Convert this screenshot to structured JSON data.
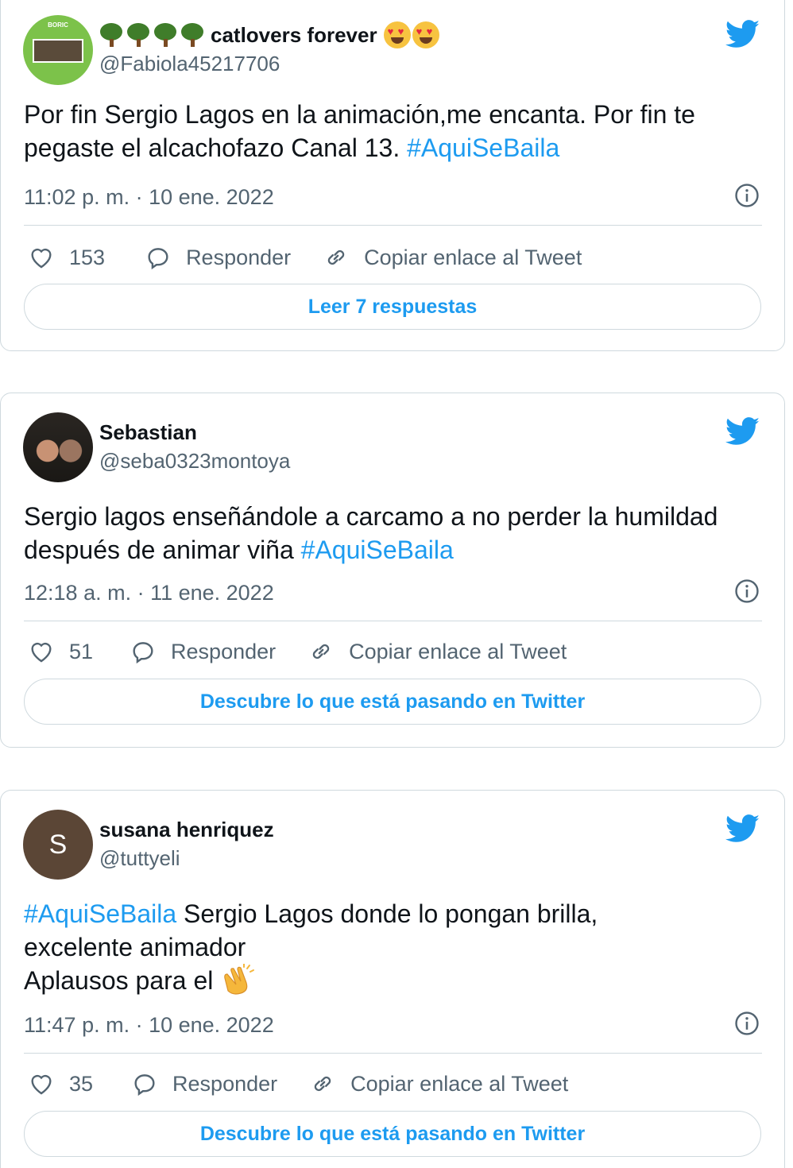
{
  "colors": {
    "accent": "#1d9bf0",
    "text": "#0f1419",
    "muted": "#536471",
    "border": "#cfd9de"
  },
  "tweets": [
    {
      "display_name": "catlovers forever",
      "handle": "@Fabiola45217706",
      "text_before": "Por fin Sergio Lagos en la animación,me encanta. Por fin te pegaste el alcachofazo Canal 13.  ",
      "hashtag": "#AquiSeBaila",
      "timestamp": "11:02 p. m. · 10 ene. 2022",
      "likes": "153",
      "reply_label": "Responder",
      "copy_label": "Copiar enlace al Tweet",
      "cta_label": "Leer 7 respuestas",
      "avatar_text": "BORIC"
    },
    {
      "display_name": "Sebastian",
      "handle": "@seba0323montoya",
      "text_before": "Sergio lagos enseñándole a carcamo a no perder la humildad después de animar viña ",
      "hashtag": "#AquiSeBaila",
      "timestamp": "12:18 a. m. · 11 ene. 2022",
      "likes": "51",
      "reply_label": "Responder",
      "copy_label": "Copiar enlace al Tweet",
      "cta_label": "Descubre lo que está pasando en Twitter"
    },
    {
      "display_name": "susana henriquez",
      "handle": "@tuttyeli",
      "hashtag": "#AquiSeBaila",
      "text_line1": " Sergio Lagos donde lo pongan brilla,",
      "text_line2": "excelente animador",
      "text_line3": "Aplausos para el ",
      "timestamp": "11:47 p. m. · 10 ene. 2022",
      "likes": "35",
      "reply_label": "Responder",
      "copy_label": "Copiar enlace al Tweet",
      "cta_label": "Descubre lo que está pasando en Twitter",
      "avatar_letter": "S"
    }
  ]
}
